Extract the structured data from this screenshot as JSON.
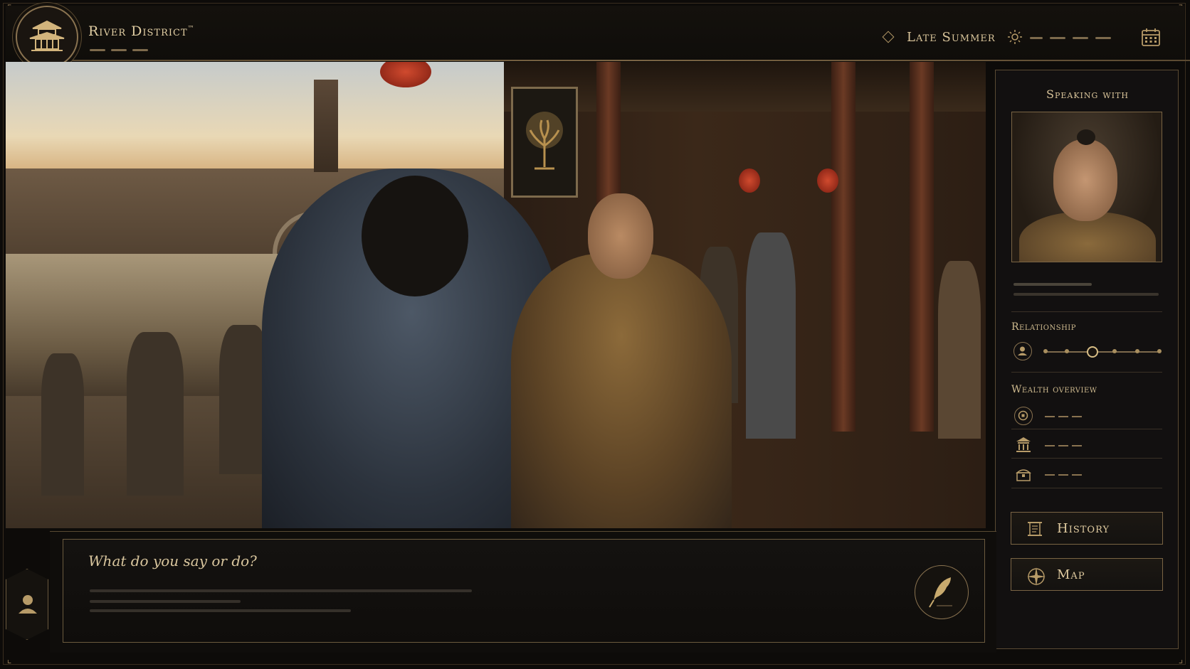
{
  "header": {
    "location_title": "River District",
    "trademark": "™",
    "season": "Late Summer"
  },
  "side_panel": {
    "speaking_with_label": "Speaking with",
    "relationship_label": "Relationship",
    "relationship_level": 0.4,
    "wealth_overview_label": "Wealth overview",
    "wealth_rows": [
      {
        "icon": "coin-icon"
      },
      {
        "icon": "building-icon"
      },
      {
        "icon": "chest-icon"
      }
    ],
    "buttons": {
      "history_label": "History",
      "map_label": "Map"
    }
  },
  "dialogue": {
    "prompt": "What do you say or do?"
  },
  "icons": {
    "emblem": "pagoda-emblem-icon",
    "season": "diamond-icon",
    "time": "sun-icon",
    "calendar": "calendar-icon",
    "quill": "quill-icon",
    "avatar": "person-icon",
    "relationship": "person-icon",
    "history": "scroll-icon",
    "map": "compass-icon"
  },
  "colors": {
    "accent_gold": "#d9c49a",
    "frame_gold": "#8a7350",
    "background": "#0d0b09"
  }
}
